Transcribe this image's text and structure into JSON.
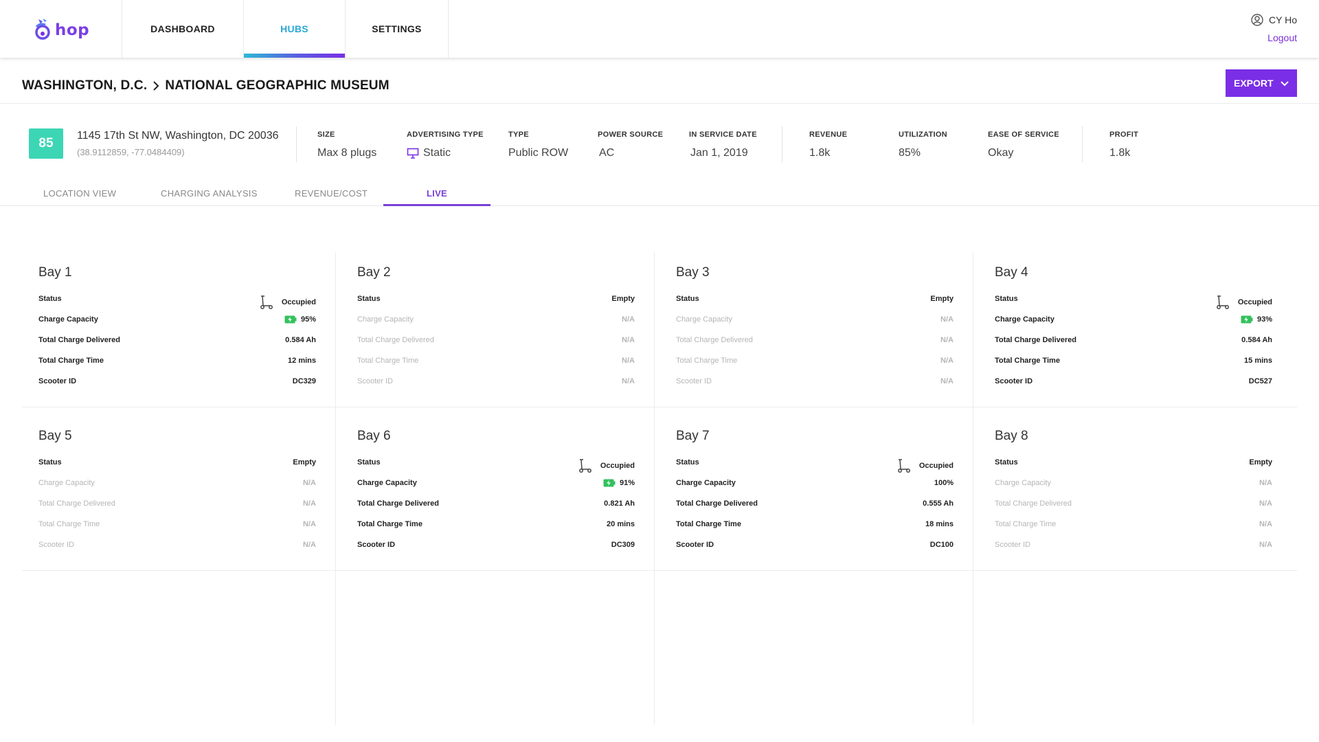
{
  "app": {
    "logo_text": "hop",
    "brand_color": "#7a2ee6",
    "accent_teal": "#3dd6b5"
  },
  "nav": {
    "tabs": [
      {
        "label": "DASHBOARD",
        "active": false
      },
      {
        "label": "HUBS",
        "active": true
      },
      {
        "label": "SETTINGS",
        "active": false
      }
    ]
  },
  "user": {
    "name": "CY Ho",
    "logout_label": "Logout",
    "icon": "user-circle-icon"
  },
  "breadcrumb": {
    "city": "WASHINGTON, D.C.",
    "separator_icon": "chevron-right-icon",
    "location": "NATIONAL GEOGRAPHIC MUSEUM"
  },
  "export_button": {
    "label": "EXPORT",
    "icon": "chevron-down-icon"
  },
  "hub": {
    "badge": "85",
    "address": "1145 17th St NW, Washington, DC 20036",
    "coordinates": "(38.9112859, -77.0484409)",
    "stats": [
      {
        "label": "SIZE",
        "value": "Max 8 plugs"
      },
      {
        "label": "ADVERTISING TYPE",
        "value": "Static",
        "icon": "monitor-icon"
      },
      {
        "label": "TYPE",
        "value": "Public ROW"
      },
      {
        "label": "POWER SOURCE",
        "value": "AC"
      },
      {
        "label": "IN SERVICE DATE",
        "value": "Jan 1, 2019"
      },
      {
        "label": "REVENUE",
        "value": "1.8k"
      },
      {
        "label": "UTILIZATION",
        "value": "85%"
      },
      {
        "label": "EASE OF SERVICE",
        "value": "Okay"
      },
      {
        "label": "PROFIT",
        "value": "1.8k"
      }
    ]
  },
  "subtabs": [
    {
      "label": "LOCATION VIEW",
      "active": false
    },
    {
      "label": "CHARGING ANALYSIS",
      "active": false
    },
    {
      "label": "REVENUE/COST",
      "active": false
    },
    {
      "label": "LIVE",
      "active": true
    }
  ],
  "bay_labels": {
    "status": "Status",
    "charge_capacity": "Charge Capacity",
    "total_charge_delivered": "Total Charge Delivered",
    "total_charge_time": "Total Charge Time",
    "scooter_id": "Scooter ID"
  },
  "bays": [
    {
      "title": "Bay 1",
      "status": "Occupied",
      "occupied": true,
      "charge_capacity": "95%",
      "total_charge_delivered": "0.584 Ah",
      "total_charge_time": "12 mins",
      "scooter_id": "DC329",
      "battery_icon": true
    },
    {
      "title": "Bay 2",
      "status": "Empty",
      "occupied": false,
      "charge_capacity": "N/A",
      "total_charge_delivered": "N/A",
      "total_charge_time": "N/A",
      "scooter_id": "N/A",
      "battery_icon": false
    },
    {
      "title": "Bay 3",
      "status": "Empty",
      "occupied": false,
      "charge_capacity": "N/A",
      "total_charge_delivered": "N/A",
      "total_charge_time": "N/A",
      "scooter_id": "N/A",
      "battery_icon": false
    },
    {
      "title": "Bay 4",
      "status": "Occupied",
      "occupied": true,
      "charge_capacity": "93%",
      "total_charge_delivered": "0.584 Ah",
      "total_charge_time": "15 mins",
      "scooter_id": "DC527",
      "battery_icon": true
    },
    {
      "title": "Bay 5",
      "status": "Empty",
      "occupied": false,
      "charge_capacity": "N/A",
      "total_charge_delivered": "N/A",
      "total_charge_time": "N/A",
      "scooter_id": "N/A",
      "battery_icon": false
    },
    {
      "title": "Bay 6",
      "status": "Occupied",
      "occupied": true,
      "charge_capacity": "91%",
      "total_charge_delivered": "0.821 Ah",
      "total_charge_time": "20 mins",
      "scooter_id": "DC309",
      "battery_icon": true
    },
    {
      "title": "Bay 7",
      "status": "Occupied",
      "occupied": true,
      "charge_capacity": "100%",
      "total_charge_delivered": "0.555 Ah",
      "total_charge_time": "18 mins",
      "scooter_id": "DC100",
      "battery_icon": false
    },
    {
      "title": "Bay 8",
      "status": "Empty",
      "occupied": false,
      "charge_capacity": "N/A",
      "total_charge_delivered": "N/A",
      "total_charge_time": "N/A",
      "scooter_id": "N/A",
      "battery_icon": false
    }
  ]
}
